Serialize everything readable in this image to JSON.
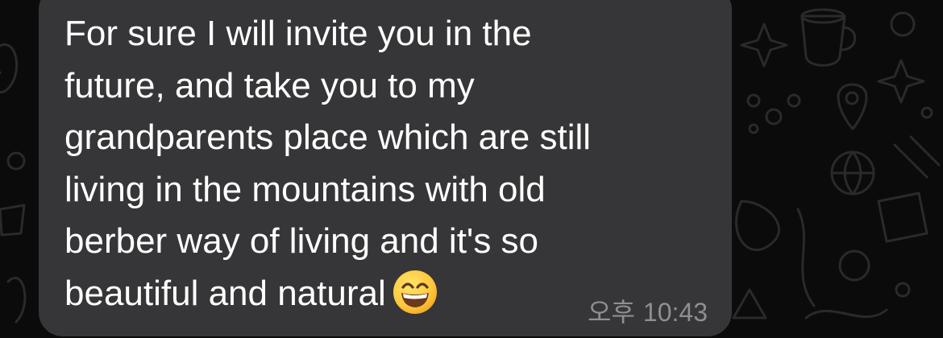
{
  "message": {
    "lines": [
      "For sure I will invite you in the",
      "future, and take you to my",
      "grandparents place which are still",
      "living in the mountains with old",
      "berber way of living and it's so",
      "beautiful and natural"
    ],
    "emoji": "grinning-face-with-smiling-eyes",
    "period": "오후",
    "time": "10:43"
  },
  "colors": {
    "background": "#0b0b0b",
    "bubble": "#363638",
    "text": "#ffffff",
    "timestamp": "#8e8e93",
    "doodle": "#2a2a2a"
  }
}
